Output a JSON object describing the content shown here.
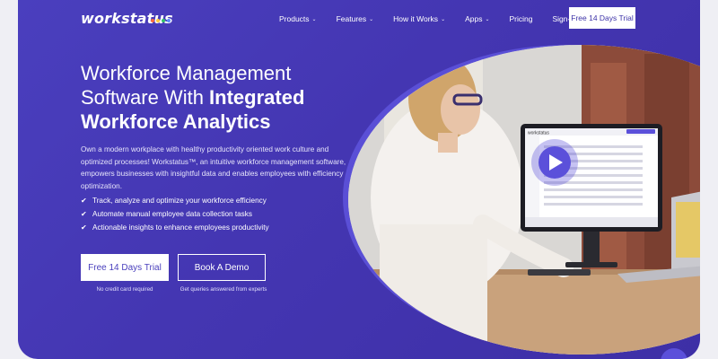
{
  "nav": {
    "logo": "workstatus",
    "logo_dot_colors": [
      "#ff6b3d",
      "#ffc93c",
      "#32c36a",
      "#5b8cff"
    ],
    "items": [
      {
        "label": "Products",
        "dropdown": true
      },
      {
        "label": "Features",
        "dropdown": true
      },
      {
        "label": "How it Works",
        "dropdown": true
      },
      {
        "label": "Apps",
        "dropdown": true
      },
      {
        "label": "Pricing",
        "dropdown": false
      },
      {
        "label": "Sign-In",
        "dropdown": false
      }
    ],
    "cta": "Free 14 Days Trial"
  },
  "hero": {
    "headline_line1": "Workforce Management",
    "headline_line2_prefix": "Software With ",
    "headline_line2_bold": "Integrated",
    "headline_line3": "Workforce Analytics",
    "description": "Own a modern workplace with healthy productivity oriented work culture and optimized processes! Workstatus™, an intuitive workforce management software, empowers businesses with insightful data and enables employees with efficiency optimization.",
    "features": [
      "Track, analyze and optimize your workforce efficiency",
      "Automate manual employee data collection tasks",
      "Actionable insights to enhance employees productivity"
    ],
    "primary_cta": "Free 14 Days Trial",
    "primary_sub": "No credit card required",
    "secondary_cta": "Book A Demo",
    "secondary_sub": "Get queries answered from experts"
  },
  "monitor": {
    "brand": "workstatus",
    "play_icon": "play-icon"
  },
  "colors": {
    "background": "#4436b2",
    "accent": "#5b50da",
    "text": "#ffffff"
  }
}
